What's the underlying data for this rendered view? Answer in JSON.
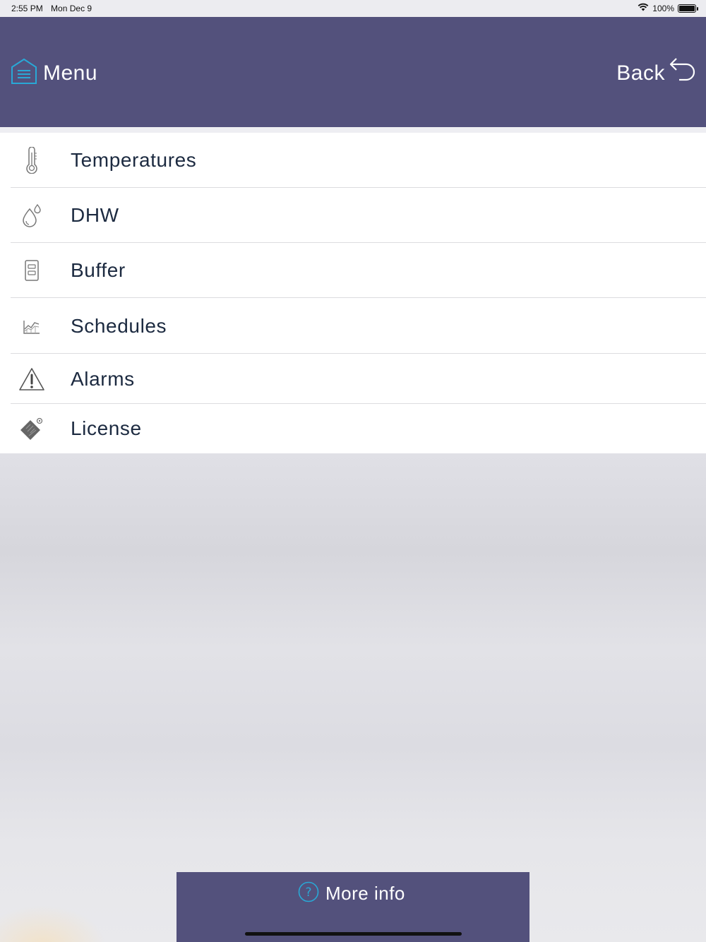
{
  "status_bar": {
    "time": "2:55 PM",
    "date": "Mon Dec 9",
    "battery": "100%",
    "icons": [
      "wifi-icon",
      "battery-icon"
    ]
  },
  "header": {
    "menu_label": "Menu",
    "menu_icon": "home-menu-icon",
    "back_label": "Back",
    "back_icon": "back-arrow-icon"
  },
  "menu": {
    "items": [
      {
        "label": "Temperatures",
        "icon": "thermometer-icon"
      },
      {
        "label": "DHW",
        "icon": "water-drops-icon"
      },
      {
        "label": "Buffer",
        "icon": "buffer-tank-icon"
      },
      {
        "label": "Schedules",
        "icon": "chart-schedule-icon"
      },
      {
        "label": "Alarms",
        "icon": "warning-triangle-icon"
      },
      {
        "label": "License",
        "icon": "license-chip-icon"
      }
    ]
  },
  "footer": {
    "more_info_label": "More info",
    "more_info_icon": "question-circle-icon"
  },
  "colors": {
    "header_bg": "#53517c",
    "accent": "#29a8d6",
    "text_dark": "#1c2a40"
  }
}
